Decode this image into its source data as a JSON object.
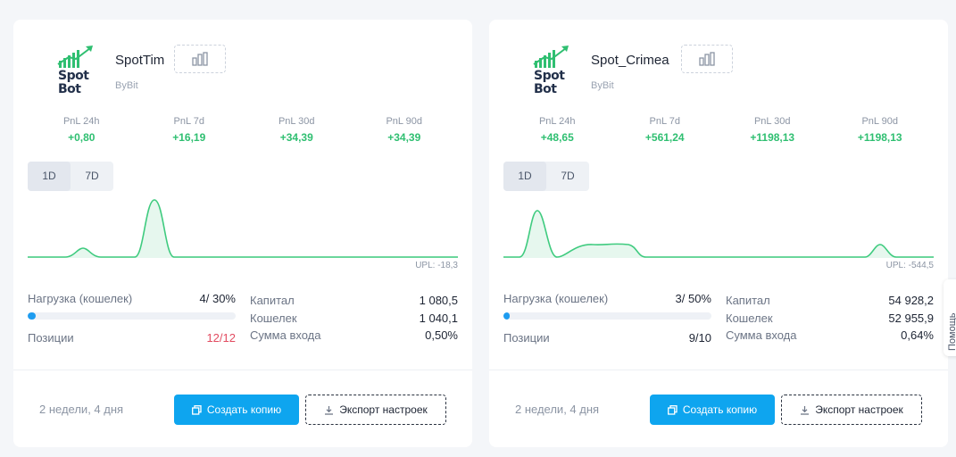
{
  "colors": {
    "positive": "#2fbf71",
    "negative": "#e24b60",
    "accent": "#0ea5ef"
  },
  "bots": [
    {
      "name": "SpotTim",
      "exchange": "ByBit",
      "logo_text": "Spot\nBot",
      "pnl": [
        {
          "label": "PnL 24h",
          "value": "+0,80"
        },
        {
          "label": "PnL 7d",
          "value": "+16,19"
        },
        {
          "label": "PnL 30d",
          "value": "+34,39"
        },
        {
          "label": "PnL 90d",
          "value": "+34,39"
        }
      ],
      "periods": [
        "1D",
        "7D"
      ],
      "upl": "UPL: -18,3",
      "load": {
        "label": "Нагрузка (кошелек)",
        "value": "4/ 30%",
        "fill": 0.04
      },
      "positions": {
        "label": "Позиции",
        "value": "12/12"
      },
      "stats": [
        {
          "label": "Капитал",
          "value": "1 080,5"
        },
        {
          "label": "Кошелек",
          "value": "1 040,1"
        },
        {
          "label": "Сумма входа",
          "value": "0,50%"
        }
      ],
      "age": "2 недели, 4 дня",
      "copy_label": "Создать копию",
      "export_label": "Экспорт настроек"
    },
    {
      "name": "Spot_Crimea",
      "exchange": "ByBit",
      "logo_text": "Spot\nBot",
      "pnl": [
        {
          "label": "PnL 24h",
          "value": "+48,65"
        },
        {
          "label": "PnL 7d",
          "value": "+561,24"
        },
        {
          "label": "PnL 30d",
          "value": "+1198,13"
        },
        {
          "label": "PnL 90d",
          "value": "+1198,13"
        }
      ],
      "periods": [
        "1D",
        "7D"
      ],
      "upl": "UPL: -544,5",
      "load": {
        "label": "Нагрузка (кошелек)",
        "value": "3/ 50%",
        "fill": 0.03
      },
      "positions": {
        "label": "Позиции",
        "value": "9/10"
      },
      "stats": [
        {
          "label": "Капитал",
          "value": "54 928,2"
        },
        {
          "label": "Кошелек",
          "value": "52 955,9"
        },
        {
          "label": "Сумма входа",
          "value": "0,64%"
        }
      ],
      "age": "2 недели, 4 дня",
      "copy_label": "Создать копию",
      "export_label": "Экспорт настроек"
    }
  ],
  "side_tab": "Помощь"
}
